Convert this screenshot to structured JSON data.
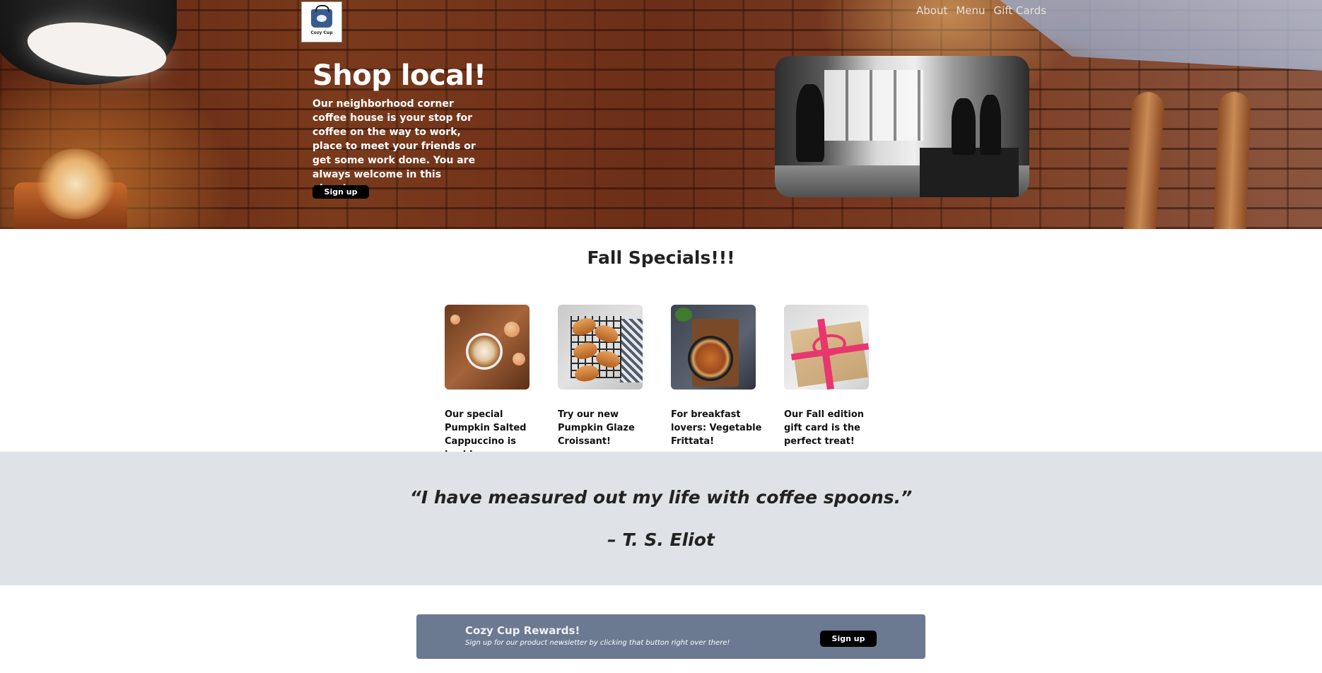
{
  "brand": {
    "logo_text": "Cozy Cup"
  },
  "nav": {
    "items": [
      {
        "label": "About"
      },
      {
        "label": "Menu"
      },
      {
        "label": "Gift Cards"
      }
    ]
  },
  "hero": {
    "title": "Shop local!",
    "text": "Our neighborhood corner coffee house is your stop for coffee on the way to work, place to meet your friends or get some work done. You are always welcome in this place!",
    "button_label": "Sign up"
  },
  "specials": {
    "title": "Fall Specials!!!",
    "cards": [
      {
        "text": "Our special Pumpkin Salted Cappuccino is back!",
        "icon": "latte-image"
      },
      {
        "text": "Try our new Pumpkin Glaze Croissant!",
        "icon": "croissant-image"
      },
      {
        "text": "For breakfast lovers: Vegetable Frittata!",
        "icon": "frittata-image"
      },
      {
        "text": "Our Fall edition gift card is the perfect treat!",
        "icon": "gift-card-image"
      }
    ]
  },
  "quote": {
    "text": "“I have measured out my life with coffee spoons.”",
    "author": "– T. S. Eliot"
  },
  "rewards": {
    "title": "Cozy Cup Rewards!",
    "subtitle": "Sign up for our product newsletter by clicking that button right over there!",
    "button_label": "Sign up"
  },
  "colors": {
    "quote_band": "#dfe2e6",
    "rewards_band": "#6b7a90",
    "button": "#000000"
  }
}
